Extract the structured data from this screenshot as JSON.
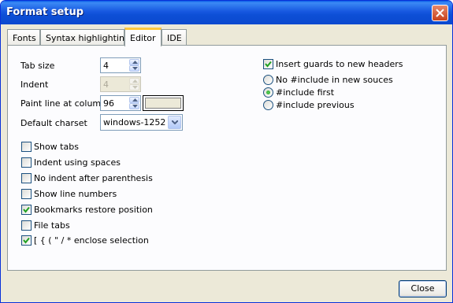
{
  "window": {
    "title": "Format setup"
  },
  "tabs": [
    "Fonts",
    "Syntax highlighting",
    "Editor",
    "IDE"
  ],
  "active_tab": "Editor",
  "editor": {
    "tab_size": {
      "label": "Tab size",
      "value": "4"
    },
    "indent": {
      "label": "Indent",
      "value": "4"
    },
    "paint_line": {
      "label": "Paint line at column",
      "value": "96"
    },
    "default_charset": {
      "label": "Default charset",
      "value": "windows-1252"
    },
    "checkboxes": [
      {
        "label": "Show tabs",
        "checked": false
      },
      {
        "label": "Indent using spaces",
        "checked": false
      },
      {
        "label": "No indent after parenthesis",
        "checked": false
      },
      {
        "label": "Show line numbers",
        "checked": false
      },
      {
        "label": "Bookmarks restore position",
        "checked": true
      },
      {
        "label": "File tabs",
        "checked": false
      },
      {
        "label": "[ { ( \" / * enclose selection",
        "checked": true
      }
    ],
    "insert_guards": {
      "label": "Insert guards to new headers",
      "checked": true
    },
    "include_options": [
      {
        "label": "No #include in new souces",
        "selected": false
      },
      {
        "label": "#include first",
        "selected": true
      },
      {
        "label": "#include previous",
        "selected": false
      }
    ]
  },
  "buttons": {
    "close": "Close"
  },
  "colors": {
    "titlebar": "#0b4fd6",
    "face": "#ece9d8",
    "check": "#21a121"
  }
}
